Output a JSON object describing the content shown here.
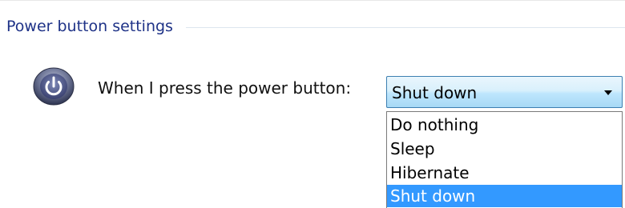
{
  "section": {
    "title": "Power button settings"
  },
  "power_button_setting": {
    "label": "When I press the power button:",
    "icon": "power-icon",
    "selected_value": "Shut down",
    "options": [
      {
        "label": "Do nothing"
      },
      {
        "label": "Sleep"
      },
      {
        "label": "Hibernate"
      },
      {
        "label": "Shut down",
        "highlighted": true
      }
    ]
  },
  "colors": {
    "section_title": "#1e3287",
    "highlight": "#3399ff",
    "dropdown_border": "#3c7fb1"
  }
}
